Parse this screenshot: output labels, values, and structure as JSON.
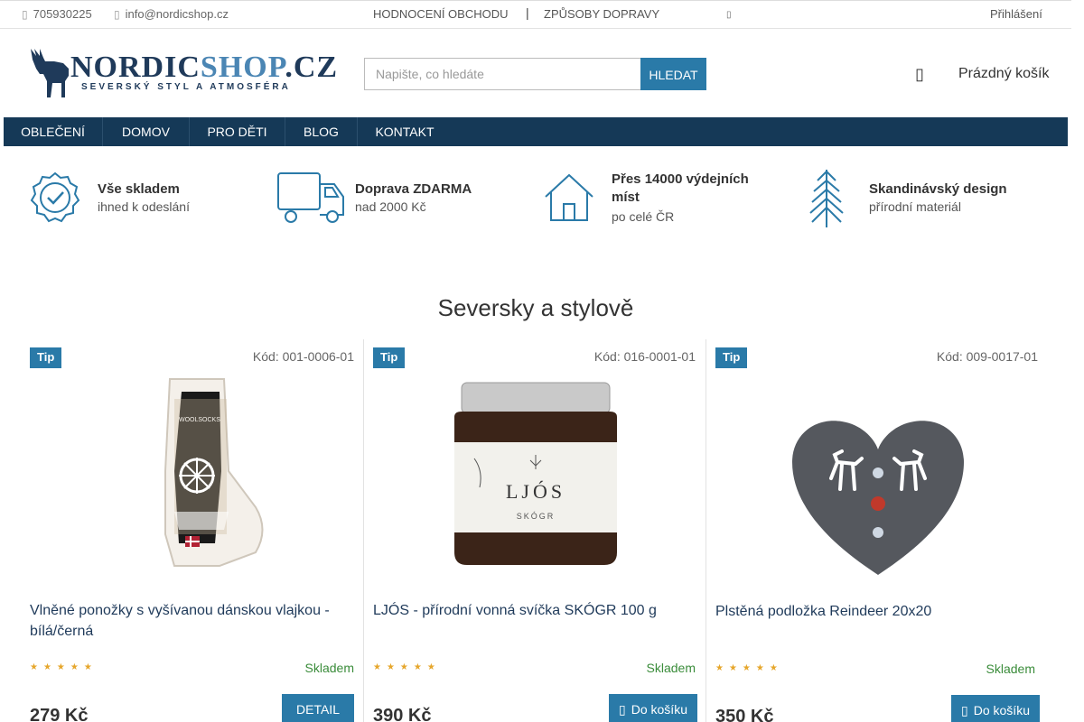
{
  "topbar": {
    "phone": "705930225",
    "email": "info@nordicshop.cz",
    "links": [
      "HODNOCENÍ OBCHODU",
      "ZPŮSOBY DOPRAVY"
    ],
    "login": "Přihlášení"
  },
  "header": {
    "logo_text": "NORDICSHOP.CZ",
    "logo_part1": "NORDIC",
    "logo_part2": "SHOP",
    "logo_part3": ".CZ",
    "logo_tagline": "SEVERSKÝ STYL A ATMOSFÉRA",
    "search_placeholder": "Napište, co hledáte",
    "search_button": "HLEDAT",
    "cart_label": "Prázdný košík"
  },
  "nav": {
    "items": [
      "OBLEČENÍ",
      "DOMOV",
      "PRO DĚTI",
      "BLOG",
      "KONTAKT"
    ]
  },
  "benefits": [
    {
      "title": "Vše skladem",
      "subtitle": "ihned k odeslání",
      "icon": "badge-check-icon"
    },
    {
      "title": "Doprava ZDARMA",
      "subtitle": "nad 2000 Kč",
      "icon": "truck-icon"
    },
    {
      "title": "Přes 14000 výdejních",
      "title2": "míst",
      "subtitle": "po celé ČR",
      "icon": "house-icon"
    },
    {
      "title": "Skandinávský design",
      "subtitle": "přírodní materiál",
      "icon": "pine-tree-icon"
    }
  ],
  "section": {
    "title": "Seversky a stylově"
  },
  "products": [
    {
      "tag": "Tip",
      "code": "Kód: 001-0006-01",
      "name": "Vlněné ponožky s vyšívanou dánskou vlajkou - bílá/černá",
      "stars": "★★★★★",
      "rating": 0,
      "stock": "Skladem",
      "price": "279 Kč",
      "button": "DETAIL"
    },
    {
      "tag": "Tip",
      "code": "Kód: 016-0001-01",
      "name": "LJÓS - přírodní vonná svíčka SKÓGR 100 g",
      "stars": "★★★★★",
      "rating": 0,
      "stock": "Skladem",
      "price": "390 Kč",
      "button": "Do košíku"
    },
    {
      "tag": "Tip",
      "code": "Kód: 009-0017-01",
      "name": "Plstěná podložka Reindeer 20x20",
      "stars": "★★★★★",
      "rating": 0,
      "stock": "Skladem",
      "price": "350 Kč",
      "button": "Do košíku"
    }
  ],
  "product_image_text": {
    "socks_label": "WOOLSOCKS",
    "candle_brand": "LJÓS",
    "candle_scent": "SKÓGR"
  },
  "colors": {
    "accent": "#2a7aa8",
    "nav_bg": "#153957",
    "stock_green": "#3a8c3a",
    "star": "#e6a62b"
  }
}
